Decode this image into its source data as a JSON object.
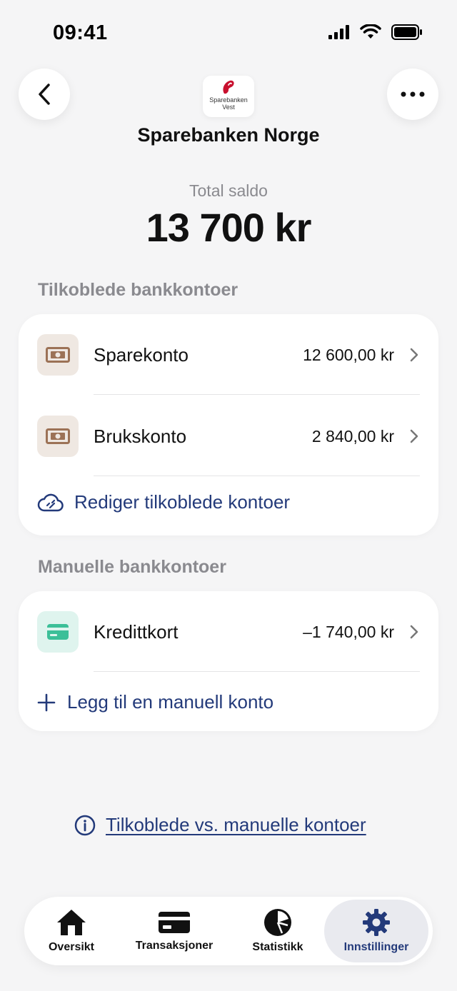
{
  "status_bar": {
    "time": "09:41"
  },
  "header": {
    "bank_logo_text_line1": "Sparebanken",
    "bank_logo_text_line2": "Vest",
    "bank_name": "Sparebanken Norge"
  },
  "total": {
    "label": "Total saldo",
    "value": "13 700 kr"
  },
  "connected": {
    "title": "Tilkoblede bankkontoer",
    "accounts": [
      {
        "name": "Sparekonto",
        "amount": "12 600,00 kr",
        "icon": "banknote-icon"
      },
      {
        "name": "Brukskonto",
        "amount": "2 840,00 kr",
        "icon": "banknote-icon"
      }
    ],
    "action_label": "Rediger tilkoblede kontoer",
    "action_icon": "cloud-link-icon"
  },
  "manual": {
    "title": "Manuelle bankkontoer",
    "accounts": [
      {
        "name": "Kredittkort",
        "amount": "–1 740,00 kr",
        "icon": "credit-card-icon"
      }
    ],
    "action_label": "Legg til en manuell konto",
    "action_icon": "plus-icon"
  },
  "info_link": {
    "label": "Tilkoblede vs. manuelle kontoer",
    "icon": "info-icon"
  },
  "tab_bar": {
    "tabs": [
      {
        "label": "Oversikt",
        "icon": "home-icon"
      },
      {
        "label": "Transaksjoner",
        "icon": "card-icon"
      },
      {
        "label": "Statistikk",
        "icon": "pie-chart-icon"
      },
      {
        "label": "Innstillinger",
        "icon": "gear-icon",
        "active": true
      }
    ]
  },
  "colors": {
    "accent": "#233a7a",
    "background": "#f5f5f6",
    "muted": "#8a8a8f",
    "brand_red": "#c8102e"
  }
}
